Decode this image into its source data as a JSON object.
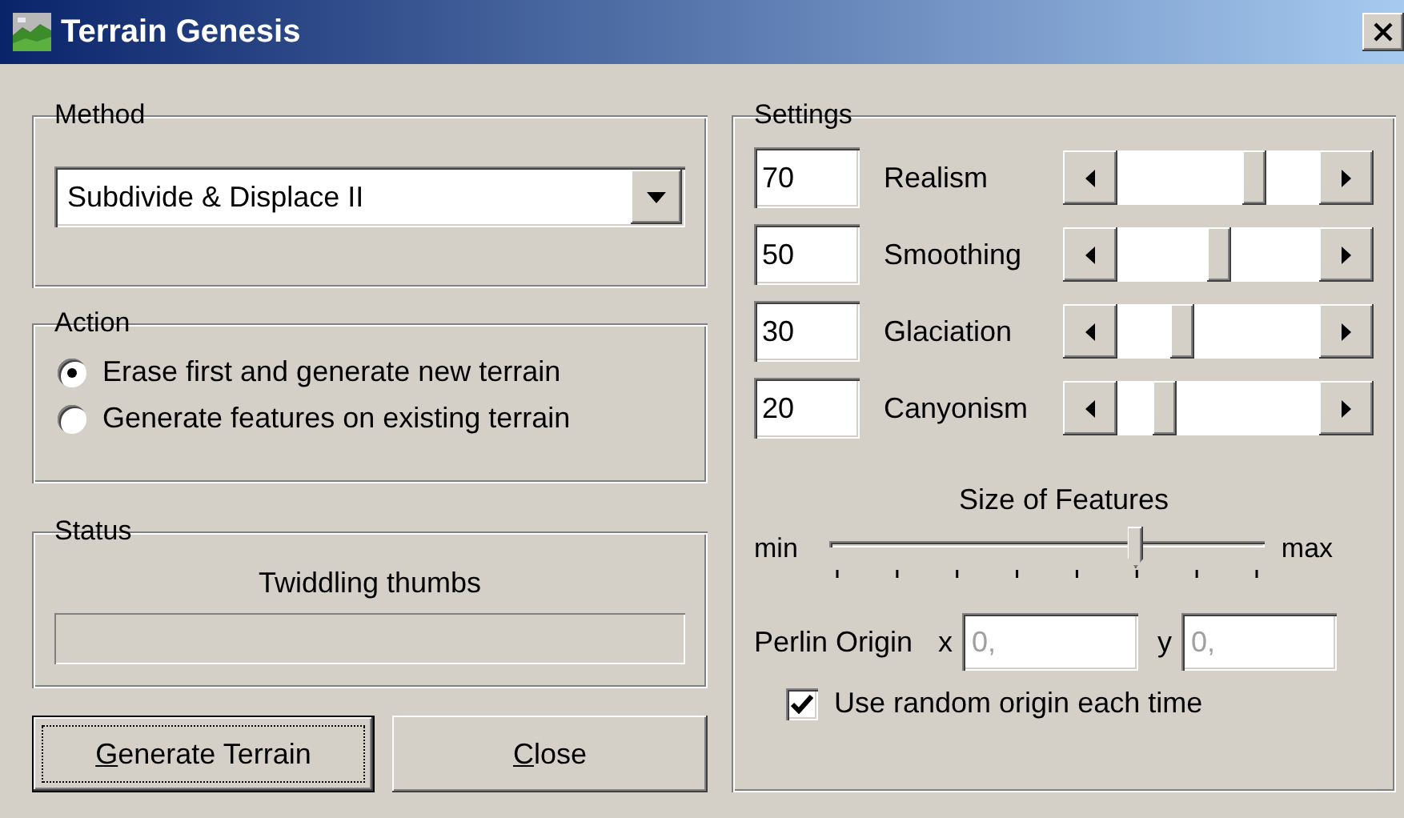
{
  "window": {
    "title": "Terrain Genesis"
  },
  "method": {
    "label": "Method",
    "value": "Subdivide & Displace II"
  },
  "action": {
    "label": "Action",
    "options": [
      {
        "label": "Erase first and generate new terrain",
        "selected": true
      },
      {
        "label": "Generate features on existing terrain",
        "selected": false
      }
    ]
  },
  "status": {
    "label": "Status",
    "message": "Twiddling thumbs",
    "progress": {
      "level": 0
    }
  },
  "buttons": [
    {
      "label": "Generate Terrain",
      "kind": "default",
      "underline_first": true
    },
    {
      "label": "Close",
      "kind": "normal",
      "underline_first": true
    }
  ],
  "settings": {
    "label": "Settings",
    "sliders": [
      {
        "value": "70",
        "name": "Realism",
        "level": 0.7
      },
      {
        "value": "50",
        "name": "Smoothing",
        "level": 0.5
      },
      {
        "value": "30",
        "name": "Glaciation",
        "level": 0.3
      },
      {
        "value": "20",
        "name": "Canyonism",
        "level": 0.2
      }
    ],
    "feature_size": {
      "label": "Size of Features",
      "min_label": "min",
      "max_label": "max",
      "level": 0.71
    },
    "perlin_origin": {
      "label": "Perlin Origin",
      "x_label": "x",
      "x_value": "0,",
      "y_label": "y",
      "y_value": "0,",
      "disabled": true
    },
    "random_origin": {
      "label": "Use random origin each time",
      "checked": true
    }
  }
}
